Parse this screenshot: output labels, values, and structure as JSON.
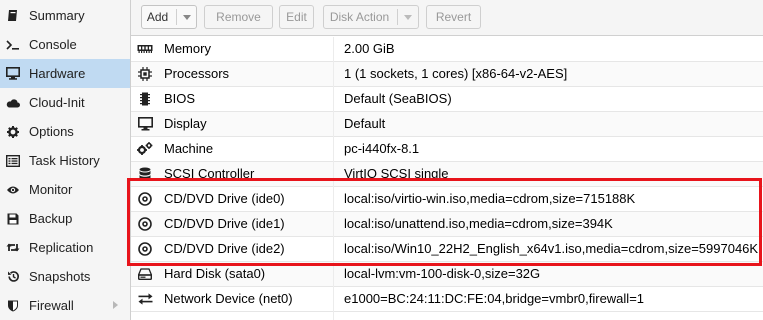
{
  "sidebar": {
    "items": [
      {
        "label": "Summary",
        "icon": "book-icon"
      },
      {
        "label": "Console",
        "icon": "terminal-icon"
      },
      {
        "label": "Hardware",
        "icon": "desktop-icon",
        "active": true
      },
      {
        "label": "Cloud-Init",
        "icon": "cloud-icon"
      },
      {
        "label": "Options",
        "icon": "gear-icon"
      },
      {
        "label": "Task History",
        "icon": "list-icon"
      },
      {
        "label": "Monitor",
        "icon": "eye-icon"
      },
      {
        "label": "Backup",
        "icon": "floppy-icon"
      },
      {
        "label": "Replication",
        "icon": "retweet-icon"
      },
      {
        "label": "Snapshots",
        "icon": "history-icon"
      },
      {
        "label": "Firewall",
        "icon": "shield-icon",
        "has_submenu": true
      }
    ]
  },
  "toolbar": {
    "add_label": "Add",
    "remove_label": "Remove",
    "edit_label": "Edit",
    "disk_action_label": "Disk Action",
    "revert_label": "Revert"
  },
  "hardware": {
    "rows": [
      {
        "icon": "memory-icon",
        "name": "Memory",
        "value": "2.00 GiB"
      },
      {
        "icon": "cpu-icon",
        "name": "Processors",
        "value": "1 (1 sockets, 1 cores) [x86-64-v2-AES]"
      },
      {
        "icon": "chip-icon",
        "name": "BIOS",
        "value": "Default (SeaBIOS)"
      },
      {
        "icon": "monitor-icon",
        "name": "Display",
        "value": "Default"
      },
      {
        "icon": "cogs-icon",
        "name": "Machine",
        "value": "pc-i440fx-8.1"
      },
      {
        "icon": "database-icon",
        "name": "SCSI Controller",
        "value": "VirtIO SCSI single"
      },
      {
        "icon": "cdrom-icon",
        "name": "CD/DVD Drive (ide0)",
        "value": "local:iso/virtio-win.iso,media=cdrom,size=715188K"
      },
      {
        "icon": "cdrom-icon",
        "name": "CD/DVD Drive (ide1)",
        "value": "local:iso/unattend.iso,media=cdrom,size=394K"
      },
      {
        "icon": "cdrom-icon",
        "name": "CD/DVD Drive (ide2)",
        "value": "local:iso/Win10_22H2_English_x64v1.iso,media=cdrom,size=5997046K"
      },
      {
        "icon": "hdd-icon",
        "name": "Hard Disk (sata0)",
        "value": "local-lvm:vm-100-disk-0,size=32G"
      },
      {
        "icon": "network-icon",
        "name": "Network Device (net0)",
        "value": "e1000=BC:24:11:DC:FE:04,bridge=vmbr0,firewall=1"
      }
    ]
  },
  "colors": {
    "highlight_border": "#e8141b",
    "active_nav": "#c0daf2"
  }
}
